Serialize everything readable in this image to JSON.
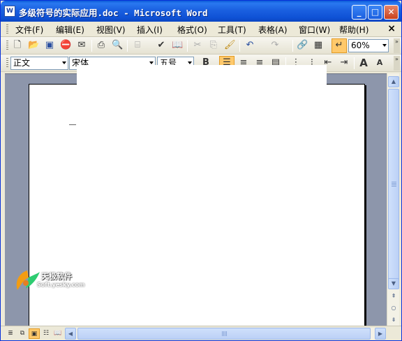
{
  "window": {
    "title": "多级符号的实际应用.doc - Microsoft Word",
    "app_icon": "W",
    "controls": {
      "minimize": "_",
      "maximize": "□",
      "close": "✕"
    }
  },
  "menubar": {
    "items": [
      {
        "label": "文件(F)"
      },
      {
        "label": "编辑(E)"
      },
      {
        "label": "视图(V)"
      },
      {
        "label": "插入(I)"
      },
      {
        "label": "格式(O)"
      },
      {
        "label": "工具(T)"
      },
      {
        "label": "表格(A)"
      },
      {
        "label": "窗口(W)"
      },
      {
        "label": "帮助(H)"
      }
    ],
    "close_doc": "×"
  },
  "toolbar_standard": {
    "icons": [
      "new-document-icon",
      "open-folder-icon",
      "save-icon",
      "permission-icon",
      "email-icon",
      "print-icon",
      "print-preview-icon",
      "research-icon",
      "spelling-icon",
      "research-book-icon",
      "cut-icon",
      "copy-icon",
      "format-painter-icon",
      "undo-icon",
      "redo-icon",
      "insert-hyperlink-icon",
      "tables-borders-icon",
      "show-hide-icon"
    ],
    "zoom": "60%"
  },
  "toolbar_formatting": {
    "style": "正文",
    "font": "宋体",
    "size": "五号",
    "bold": "B",
    "icons": [
      "align-left-icon",
      "align-center-icon",
      "align-right-icon",
      "justify-icon",
      "numbering-icon",
      "bullets-icon",
      "decrease-indent-icon",
      "increase-indent-icon",
      "grow-font-icon",
      "shrink-font-icon"
    ],
    "grow_font": "A",
    "shrink_font": "A"
  },
  "watermark": {
    "name": "天极软件",
    "sub": "Soft.yesky.com"
  },
  "colors": {
    "title_bar": "#0a5bd8",
    "workspace": "#8d96ab",
    "active_button": "#ffc96b",
    "chrome": "#ece9d8"
  }
}
